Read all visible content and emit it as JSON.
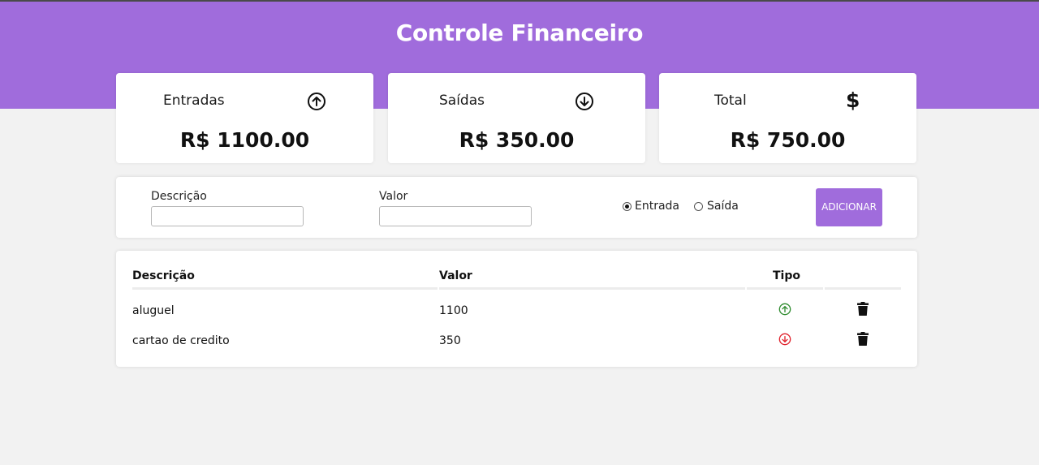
{
  "header": {
    "title": "Controle Financeiro"
  },
  "cards": [
    {
      "label": "Entradas",
      "icon": "arrow-up-circle-icon",
      "value": "R$ 1100.00"
    },
    {
      "label": "Saídas",
      "icon": "arrow-down-circle-icon",
      "value": "R$ 350.00"
    },
    {
      "label": "Total",
      "icon": "dollar-icon",
      "symbol": "$",
      "value": "R$ 750.00"
    }
  ],
  "form": {
    "description_label": "Descrição",
    "description_value": "",
    "amount_label": "Valor",
    "amount_value": "",
    "type_options": [
      "Entrada",
      "Saída"
    ],
    "type_selected": "Entrada",
    "add_button": "ADICIONAR"
  },
  "table": {
    "headers": [
      "Descrição",
      "Valor",
      "Tipo"
    ],
    "rows": [
      {
        "description": "aluguel",
        "amount": "1100",
        "type": "entrada"
      },
      {
        "description": "cartao de credito",
        "amount": "350",
        "type": "saida"
      }
    ]
  },
  "colors": {
    "accent": "#a06cdc",
    "income_icon": "#2e8b2e",
    "expense_icon": "#e0202a",
    "background": "#f2f2f2"
  }
}
